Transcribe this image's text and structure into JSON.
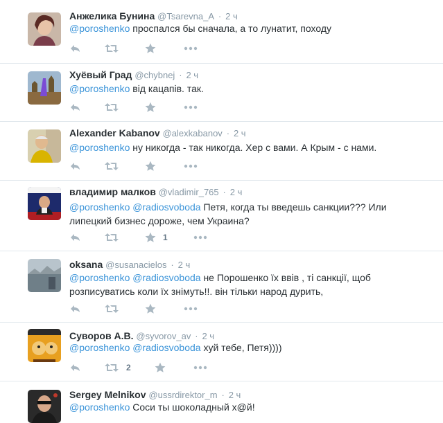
{
  "tweets": [
    {
      "name": "Анжелика Бунина",
      "handle": "@Tsarevna_A",
      "time": "2 ч",
      "mentions": [
        "@poroshenko"
      ],
      "lines": [
        "проспался бы сначала, а то лунатит, походу"
      ],
      "retweet_count": "",
      "favorite_count": ""
    },
    {
      "name": "Хуёвый Град",
      "handle": "@chybnej",
      "time": "2 ч",
      "mentions": [
        "@poroshenko"
      ],
      "lines": [
        "від кацапів. так."
      ],
      "retweet_count": "",
      "favorite_count": ""
    },
    {
      "name": "Alexander Kabanov",
      "handle": "@alexkabanov",
      "time": "2 ч",
      "mentions": [
        "@poroshenko"
      ],
      "lines": [
        "ну никогда - так никогда. Хер с вами. А Крым - с нами."
      ],
      "retweet_count": "",
      "favorite_count": ""
    },
    {
      "name": "владимир малков",
      "handle": "@vladimir_765",
      "time": "2 ч",
      "mentions": [
        "@poroshenko",
        "@radiosvoboda"
      ],
      "lines": [
        "Петя, когда ты введешь санкции??? Или",
        "липецкий бизнес дороже, чем Украина?"
      ],
      "retweet_count": "",
      "favorite_count": "1"
    },
    {
      "name": "oksana",
      "handle": "@susanacielos",
      "time": "2 ч",
      "mentions": [
        "@poroshenko",
        "@radiosvoboda"
      ],
      "lines": [
        "не Порошенко їх ввів , ті санкції, щоб",
        "розписуватись коли їх знімуть!!. він тільки народ дурить,"
      ],
      "retweet_count": "",
      "favorite_count": ""
    },
    {
      "name": "Суворов А.В.",
      "handle": "@syvorov_av",
      "time": "2 ч",
      "mentions": [
        "@poroshenko",
        "@radiosvoboda"
      ],
      "lines": [
        "хуй тебе, Петя))))"
      ],
      "retweet_count": "2",
      "favorite_count": ""
    },
    {
      "name": "Sergey Melnikov",
      "handle": "@ussrdirektor_m",
      "time": "2 ч",
      "mentions": [
        "@poroshenko"
      ],
      "lines": [
        "Соси ты шоколадный х@й!"
      ],
      "retweet_count": "",
      "favorite_count": ""
    }
  ],
  "colors": {
    "link": "#3b94d9",
    "icon": "#aab8c2",
    "meta": "#8899a6",
    "divider": "#e1e8ed"
  },
  "icons": [
    "reply-icon",
    "retweet-icon",
    "favorite-icon",
    "more-icon"
  ]
}
